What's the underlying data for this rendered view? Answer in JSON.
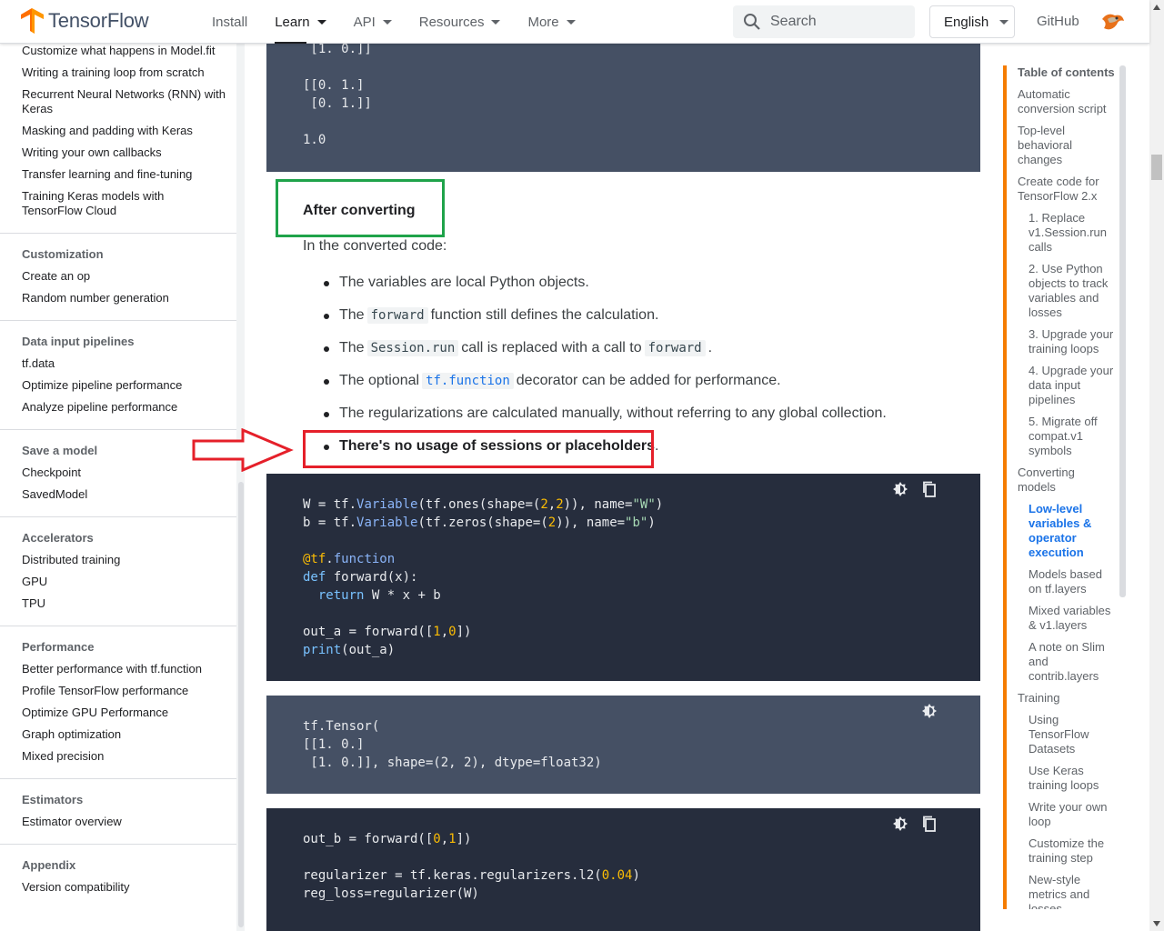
{
  "header": {
    "brand": "TensorFlow",
    "nav": [
      {
        "label": "Install",
        "dropdown": false
      },
      {
        "label": "Learn",
        "dropdown": true,
        "active": true
      },
      {
        "label": "API",
        "dropdown": true
      },
      {
        "label": "Resources",
        "dropdown": true
      },
      {
        "label": "More",
        "dropdown": true
      }
    ],
    "search_placeholder": "Search",
    "language": "English",
    "github": "GitHub"
  },
  "sidebar": {
    "top_items": [
      "Customize what happens in Model.fit",
      "Writing a training loop from scratch",
      "Recurrent Neural Networks (RNN) with Keras",
      "Masking and padding with Keras",
      "Writing your own callbacks",
      "Transfer learning and fine-tuning",
      "Training Keras models with TensorFlow Cloud"
    ],
    "sections": [
      {
        "title": "Customization",
        "items": [
          "Create an op",
          "Random number generation"
        ]
      },
      {
        "title": "Data input pipelines",
        "items": [
          "tf.data",
          "Optimize pipeline performance",
          "Analyze pipeline performance"
        ]
      },
      {
        "title": "Save a model",
        "items": [
          "Checkpoint",
          "SavedModel"
        ]
      },
      {
        "title": "Accelerators",
        "items": [
          "Distributed training",
          "GPU",
          "TPU"
        ]
      },
      {
        "title": "Performance",
        "items": [
          "Better performance with tf.function",
          "Profile TensorFlow performance",
          "Optimize GPU Performance",
          "Graph optimization",
          "Mixed precision"
        ]
      },
      {
        "title": "Estimators",
        "items": [
          "Estimator overview"
        ]
      },
      {
        "title": "Appendix",
        "items": [
          "Version compatibility"
        ]
      }
    ]
  },
  "content": {
    "output1_lines": [
      " [1. 0.]]",
      "",
      "[[0. 1.]",
      " [0. 1.]]",
      "",
      "1.0"
    ],
    "after_heading": "After converting",
    "intro": "In the converted code:",
    "bullets": {
      "b1": "The variables are local Python objects.",
      "b2_pre": "The",
      "b2_code": "forward",
      "b2_post": "function still defines the calculation.",
      "b3_pre": "The",
      "b3_code": "Session.run",
      "b3_mid": "call is replaced with a call to",
      "b3_code2": "forward",
      "b3_post": ".",
      "b4_pre": "The optional",
      "b4_code": "tf.function",
      "b4_post": "decorator can be added for performance.",
      "b5": "The regularizations are calculated manually, without referring to any global collection.",
      "b6_bold": "There's no usage of sessions or placeholders",
      "b6_post": "."
    },
    "output2_lines": [
      "tf.Tensor(",
      "[[1. 0.]",
      " [1. 0.]], shape=(2, 2), dtype=float32)"
    ]
  },
  "toc": {
    "title": "Table of contents",
    "items": [
      {
        "label": "Automatic conversion script",
        "level": 1
      },
      {
        "label": "Top-level behavioral changes",
        "level": 1
      },
      {
        "label": "Create code for TensorFlow 2.x",
        "level": 1
      },
      {
        "label": "1. Replace v1.Session.run calls",
        "level": 2
      },
      {
        "label": "2. Use Python objects to track variables and losses",
        "level": 2
      },
      {
        "label": "3. Upgrade your training loops",
        "level": 2
      },
      {
        "label": "4. Upgrade your data input pipelines",
        "level": 2
      },
      {
        "label": "5. Migrate off compat.v1 symbols",
        "level": 2
      },
      {
        "label": "Converting models",
        "level": 1
      },
      {
        "label": "Low-level variables & operator execution",
        "level": 2,
        "active": true
      },
      {
        "label": "Models based on tf.layers",
        "level": 2
      },
      {
        "label": "Mixed variables & v1.layers",
        "level": 2
      },
      {
        "label": "A note on Slim and contrib.layers",
        "level": 2
      },
      {
        "label": "Training",
        "level": 1
      },
      {
        "label": "Using TensorFlow Datasets",
        "level": 2
      },
      {
        "label": "Use Keras training loops",
        "level": 2
      },
      {
        "label": "Write your own loop",
        "level": 2
      },
      {
        "label": "Customize the training step",
        "level": 2
      },
      {
        "label": "New-style metrics and losses",
        "level": 2
      }
    ]
  },
  "colors": {
    "accent": "#1a73e8",
    "toc_bar": "#f57c00",
    "highlight_green": "#1fa34a",
    "highlight_red": "#e5202a"
  }
}
